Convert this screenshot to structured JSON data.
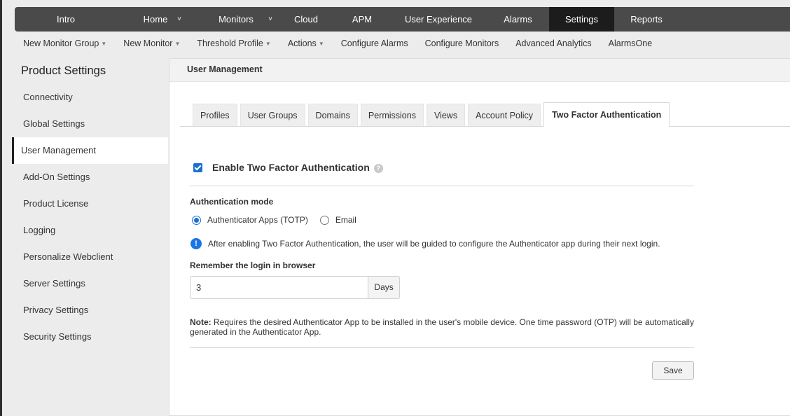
{
  "topnav": {
    "items": [
      {
        "label": "Intro"
      },
      {
        "label": "Home"
      },
      {
        "label": "Monitors"
      },
      {
        "label": "Cloud"
      },
      {
        "label": "APM"
      },
      {
        "label": "User Experience"
      },
      {
        "label": "Alarms"
      },
      {
        "label": "Settings"
      },
      {
        "label": "Reports"
      }
    ],
    "active": "Settings"
  },
  "subnav": {
    "items": [
      {
        "label": "New Monitor Group"
      },
      {
        "label": "New Monitor"
      },
      {
        "label": "Threshold Profile"
      },
      {
        "label": "Actions"
      },
      {
        "label": "Configure Alarms"
      },
      {
        "label": "Configure Monitors"
      },
      {
        "label": "Advanced Analytics"
      },
      {
        "label": "AlarmsOne"
      }
    ]
  },
  "sidebar": {
    "title": "Product Settings",
    "items": [
      {
        "label": "Connectivity"
      },
      {
        "label": "Global Settings"
      },
      {
        "label": "User Management"
      },
      {
        "label": "Add-On Settings"
      },
      {
        "label": "Product License"
      },
      {
        "label": "Logging"
      },
      {
        "label": "Personalize Webclient"
      },
      {
        "label": "Server Settings"
      },
      {
        "label": "Privacy Settings"
      },
      {
        "label": "Security Settings"
      }
    ],
    "active": "User Management"
  },
  "main": {
    "header": "User Management",
    "tabs": [
      {
        "label": "Profiles"
      },
      {
        "label": "User Groups"
      },
      {
        "label": "Domains"
      },
      {
        "label": "Permissions"
      },
      {
        "label": "Views"
      },
      {
        "label": "Account Policy"
      },
      {
        "label": "Two Factor Authentication"
      }
    ],
    "active_tab": "Two Factor Authentication",
    "enable_label": "Enable Two Factor Authentication",
    "enable_checked": true,
    "help_glyph": "?",
    "auth_mode_label": "Authentication mode",
    "auth_options": [
      {
        "label": "Authenticator Apps (TOTP)",
        "checked": true
      },
      {
        "label": "Email",
        "checked": false
      }
    ],
    "info_glyph": "!",
    "info_text": "After enabling Two Factor Authentication, the user will be guided to configure the Authenticator app during their next login.",
    "remember_label": "Remember the login in browser",
    "remember_value": "3",
    "remember_unit": "Days",
    "note_label": "Note:",
    "note_text": " Requires the desired Authenticator App to be installed in the user's mobile device. One time password (OTP) will be automatically generated in the Authenticator App.",
    "save_label": "Save"
  },
  "colors": {
    "topnav_bg": "#4a4a4a",
    "topnav_active": "#1c1c1c",
    "accent": "#1a6fd1",
    "info": "#1a73e8"
  }
}
